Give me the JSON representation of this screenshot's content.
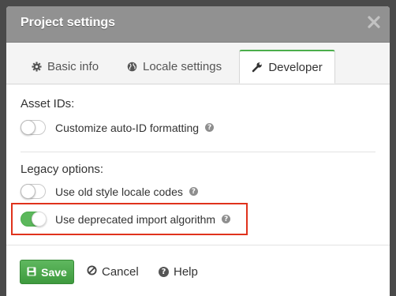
{
  "dialog": {
    "title": "Project settings"
  },
  "tabs": [
    {
      "label": "Basic info",
      "icon": "gear-icon",
      "active": false
    },
    {
      "label": "Locale settings",
      "icon": "globe-icon",
      "active": false
    },
    {
      "label": "Developer",
      "icon": "wrench-icon",
      "active": true
    }
  ],
  "sections": {
    "asset_ids": {
      "label": "Asset IDs:",
      "options": [
        {
          "label": "Customize auto-ID formatting",
          "enabled": false
        }
      ]
    },
    "legacy": {
      "label": "Legacy options:",
      "options": [
        {
          "label": "Use old style locale codes",
          "enabled": false
        },
        {
          "label": "Use deprecated import algorithm",
          "enabled": true
        }
      ]
    }
  },
  "footer": {
    "save_label": "Save",
    "cancel_label": "Cancel",
    "help_label": "Help"
  },
  "colors": {
    "accent_green": "#5cb85c",
    "highlight_red": "#e0321c",
    "titlebar_gray": "#919191"
  },
  "icons": {
    "help_glyph": "?"
  }
}
